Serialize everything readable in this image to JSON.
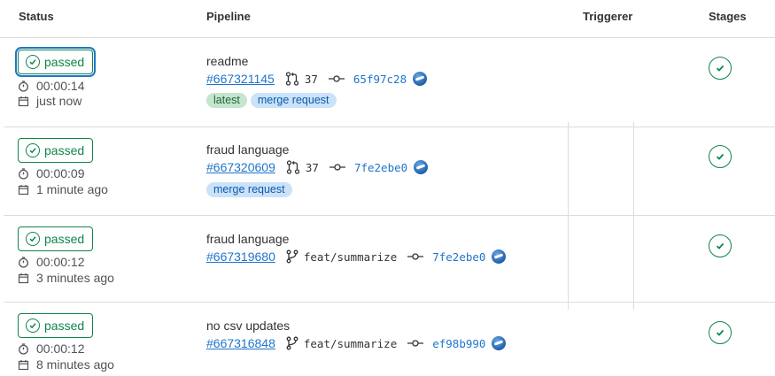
{
  "table": {
    "headers": {
      "status": "Status",
      "pipeline": "Pipeline",
      "triggerer": "Triggerer",
      "stages": "Stages"
    },
    "rows": [
      {
        "status": "passed",
        "duration": "00:00:14",
        "time_ago": "just now",
        "title": "readme",
        "pipeline_id": "#667321145",
        "ref_type": "merge-request",
        "ref": "37",
        "sha": "65f97c28",
        "badges": [
          "latest",
          "merge request"
        ]
      },
      {
        "status": "passed",
        "duration": "00:00:09",
        "time_ago": "1 minute ago",
        "title": "fraud language",
        "pipeline_id": "#667320609",
        "ref_type": "merge-request",
        "ref": "37",
        "sha": "7fe2ebe0",
        "badges": [
          "merge request"
        ]
      },
      {
        "status": "passed",
        "duration": "00:00:12",
        "time_ago": "3 minutes ago",
        "title": "fraud language",
        "pipeline_id": "#667319680",
        "ref_type": "branch",
        "ref": "feat/summarize",
        "sha": "7fe2ebe0",
        "badges": []
      },
      {
        "status": "passed",
        "duration": "00:00:12",
        "time_ago": "8 minutes ago",
        "title": "no csv updates",
        "pipeline_id": "#667316848",
        "ref_type": "branch",
        "ref": "feat/summarize",
        "sha": "ef98b990",
        "badges": []
      }
    ]
  },
  "colors": {
    "success": "#108548",
    "link": "#1f75cb",
    "badge_green_bg": "#c3e6cd",
    "badge_blue_bg": "#cbe2f9"
  },
  "icons": {
    "status": "check-circle-icon",
    "duration": "timer-icon",
    "date": "calendar-icon",
    "merge_request": "merge-request-icon",
    "branch": "branch-icon",
    "commit": "commit-icon",
    "avatar": "user-avatar",
    "stage": "stage-passed-icon"
  }
}
